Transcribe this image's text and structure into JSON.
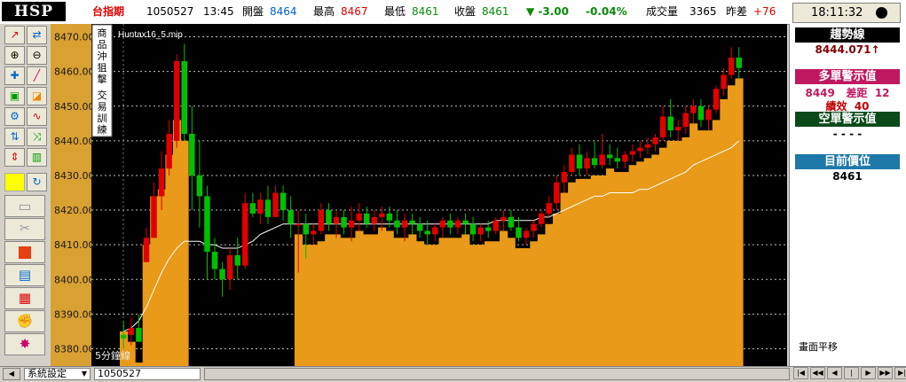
{
  "app": {
    "logo": "HSP"
  },
  "quote": {
    "symbol": "台指期",
    "date": "1050527",
    "time": "13:45",
    "open_label": "開盤",
    "open": "8464",
    "high_label": "最高",
    "high": "8467",
    "low_label": "最低",
    "low": "8461",
    "close_label": "收盤",
    "close": "8461",
    "change": "▼ -3.00",
    "change_pct": "-0.04%",
    "volume_label": "成交量",
    "volume": "3365",
    "spread_label": "昨差",
    "spread": "+76",
    "clock": "18:11:32"
  },
  "colors": {
    "up": "#e00000",
    "down": "#00c000",
    "fill": "#e89a18",
    "background": "#000000",
    "ma": "#ffffff"
  },
  "toolbar": {
    "icons": [
      "trend-line-icon",
      "fit-icon",
      "zoom-in-icon",
      "zoom-out-icon",
      "crosshair-icon",
      "pen-icon",
      "lock-icon",
      "eraser-icon",
      "settings-icon",
      "wave-icon",
      "candle-icon",
      "shuffle-icon",
      "up-down-icon",
      "bar-chart-icon",
      "yellow-color-icon",
      "refresh-icon"
    ],
    "wide_icons": [
      "folder-icon",
      "scissors-icon",
      "stop-icon",
      "print-icon",
      "table-icon",
      "gloves-icon",
      "burst-icon"
    ]
  },
  "chart": {
    "file_label": "Huntax16_5.mip",
    "interval_label": "5分鐘線",
    "side_tab_1": "商品沖狙擊",
    "side_tab_2": "交易訓練",
    "right_label": "畫面平移"
  },
  "panel": {
    "trend_title": "趨勢線",
    "trend_value": "8444.071↑",
    "bull_title": "多單警示值",
    "bull_value": "8449",
    "bull_gap_label": "差距",
    "bull_gap": "12",
    "perf_label": "績效",
    "perf": "40",
    "bear_title": "空單警示值",
    "bear_value": "- - - -",
    "pos_title": "目前價位",
    "pos_value": "8461"
  },
  "bottom": {
    "settings_label": "系統設定",
    "date_value": "1050527"
  },
  "chart_data": {
    "type": "candlestick",
    "y_range": [
      8375,
      8475
    ],
    "y_ticks": [
      "8470.00",
      "8460.00",
      "8450.00",
      "8440.00",
      "8430.00",
      "8420.00",
      "8410.00",
      "8400.00",
      "8390.00",
      "8380.00"
    ],
    "grid": true,
    "ohlc": [
      [
        8384,
        8388,
        8380,
        8383
      ],
      [
        8384,
        8389,
        8381,
        8386
      ],
      [
        8386,
        8390,
        8383,
        8382
      ],
      [
        8405,
        8415,
        8405,
        8412
      ],
      [
        8412,
        8428,
        8412,
        8424
      ],
      [
        8424,
        8437,
        8420,
        8432
      ],
      [
        8432,
        8446,
        8430,
        8442
      ],
      [
        8440,
        8465,
        8438,
        8463
      ],
      [
        8463,
        8468,
        8440,
        8442
      ],
      [
        8442,
        8450,
        8420,
        8430
      ],
      [
        8430,
        8440,
        8415,
        8424
      ],
      [
        8424,
        8427,
        8400,
        8408
      ],
      [
        8408,
        8412,
        8400,
        8403
      ],
      [
        8403,
        8405,
        8395,
        8400
      ],
      [
        8400,
        8409,
        8397,
        8407
      ],
      [
        8407,
        8412,
        8400,
        8404
      ],
      [
        8404,
        8425,
        8403,
        8422
      ],
      [
        8422,
        8425,
        8418,
        8419
      ],
      [
        8419,
        8425,
        8416,
        8423
      ],
      [
        8423,
        8427,
        8416,
        8418
      ],
      [
        8418,
        8427,
        8418,
        8425
      ],
      [
        8425,
        8427,
        8417,
        8420
      ],
      [
        8420,
        8424,
        8412,
        8416
      ],
      [
        8416,
        8420,
        8402,
        8416
      ],
      [
        8416,
        8419,
        8406,
        8413
      ],
      [
        8413,
        8416,
        8410,
        8414
      ],
      [
        8414,
        8422,
        8413,
        8420
      ],
      [
        8420,
        8422,
        8414,
        8416
      ],
      [
        8416,
        8420,
        8412,
        8418
      ],
      [
        8418,
        8420,
        8413,
        8415
      ],
      [
        8415,
        8421,
        8411,
        8417
      ],
      [
        8417,
        8422,
        8414,
        8419
      ],
      [
        8419,
        8421,
        8415,
        8416
      ],
      [
        8416,
        8420,
        8414,
        8418
      ],
      [
        8418,
        8421,
        8414,
        8419
      ],
      [
        8419,
        8421,
        8415,
        8417
      ],
      [
        8417,
        8420,
        8413,
        8415
      ],
      [
        8415,
        8419,
        8411,
        8417
      ],
      [
        8417,
        8419,
        8413,
        8416
      ],
      [
        8416,
        8418,
        8412,
        8414
      ],
      [
        8414,
        8417,
        8410,
        8413
      ],
      [
        8413,
        8416,
        8411,
        8415
      ],
      [
        8415,
        8418,
        8412,
        8417
      ],
      [
        8417,
        8419,
        8413,
        8415
      ],
      [
        8415,
        8418,
        8413,
        8417
      ],
      [
        8417,
        8419,
        8413,
        8416
      ],
      [
        8416,
        8418,
        8411,
        8413
      ],
      [
        8413,
        8416,
        8411,
        8415
      ],
      [
        8415,
        8417,
        8412,
        8414
      ],
      [
        8414,
        8418,
        8413,
        8417
      ],
      [
        8417,
        8420,
        8414,
        8418
      ],
      [
        8418,
        8420,
        8414,
        8415
      ],
      [
        8415,
        8418,
        8411,
        8412
      ],
      [
        8412,
        8415,
        8410,
        8414
      ],
      [
        8414,
        8417,
        8412,
        8416
      ],
      [
        8416,
        8420,
        8415,
        8419
      ],
      [
        8419,
        8424,
        8418,
        8422
      ],
      [
        8422,
        8430,
        8420,
        8428
      ],
      [
        8428,
        8433,
        8425,
        8431
      ],
      [
        8431,
        8438,
        8430,
        8436
      ],
      [
        8436,
        8439,
        8430,
        8432
      ],
      [
        8432,
        8437,
        8430,
        8435
      ],
      [
        8435,
        8440,
        8432,
        8433
      ],
      [
        8433,
        8442,
        8432,
        8436
      ],
      [
        8436,
        8439,
        8433,
        8435
      ],
      [
        8435,
        8438,
        8432,
        8434
      ],
      [
        8434,
        8437,
        8432,
        8436
      ],
      [
        8436,
        8439,
        8434,
        8437
      ],
      [
        8437,
        8440,
        8435,
        8438
      ],
      [
        8438,
        8441,
        8436,
        8439
      ],
      [
        8439,
        8442,
        8437,
        8441
      ],
      [
        8441,
        8450,
        8440,
        8447
      ],
      [
        8447,
        8452,
        8441,
        8443
      ],
      [
        8443,
        8446,
        8440,
        8444
      ],
      [
        8444,
        8450,
        8442,
        8448
      ],
      [
        8448,
        8452,
        8445,
        8450
      ],
      [
        8450,
        8452,
        8444,
        8446
      ],
      [
        8446,
        8450,
        8443,
        8449
      ],
      [
        8449,
        8456,
        8448,
        8455
      ],
      [
        8455,
        8461,
        8453,
        8459
      ],
      [
        8459,
        8467,
        8458,
        8464
      ],
      [
        8464,
        8467,
        8458,
        8461
      ]
    ],
    "band": [
      8385,
      8382,
      8376,
      8410,
      8424,
      8426,
      8436,
      8446,
      8440,
      8373,
      8373,
      8373,
      8373,
      8373,
      8373,
      8373,
      8373,
      8373,
      8373,
      8373,
      8373,
      8373,
      8373,
      8373,
      8373,
      8373,
      8373,
      8373,
      8373,
      8373,
      8373,
      8373,
      8373,
      8373,
      8373,
      8373,
      8373,
      8373,
      8373,
      8373,
      8373,
      8373,
      8373,
      8373,
      8373,
      8373,
      8373,
      8373,
      8373,
      8373,
      8373,
      8373,
      8373,
      8373,
      8373,
      8373,
      8373,
      8373,
      8373,
      8373,
      8373,
      8373,
      8373,
      8373,
      8373,
      8373,
      8373,
      8373,
      8373,
      8373,
      8373,
      8373,
      8373,
      8373,
      8373,
      8373,
      8373,
      8373,
      8373,
      8373,
      8373,
      8373
    ],
    "ma": [
      8385,
      8386,
      8388,
      8392,
      8397,
      8402,
      8406,
      8409,
      8411,
      8411,
      8411,
      8410,
      8410,
      8409,
      8409,
      8409,
      8410,
      8411,
      8413,
      8414,
      8415,
      8416,
      8416,
      8416,
      8416,
      8416,
      8416,
      8416,
      8416,
      8416,
      8416,
      8416,
      8416,
      8416,
      8416,
      8416,
      8416,
      8416,
      8416,
      8416,
      8416,
      8416,
      8416,
      8416,
      8416,
      8416,
      8416,
      8416,
      8416,
      8417,
      8417,
      8417,
      8417,
      8417,
      8417,
      8418,
      8418,
      8419,
      8420,
      8421,
      8422,
      8423,
      8424,
      8424,
      8425,
      8425,
      8425,
      8425,
      8426,
      8426,
      8427,
      8428,
      8429,
      8430,
      8431,
      8433,
      8434,
      8435,
      8436,
      8437,
      8438,
      8440
    ]
  }
}
